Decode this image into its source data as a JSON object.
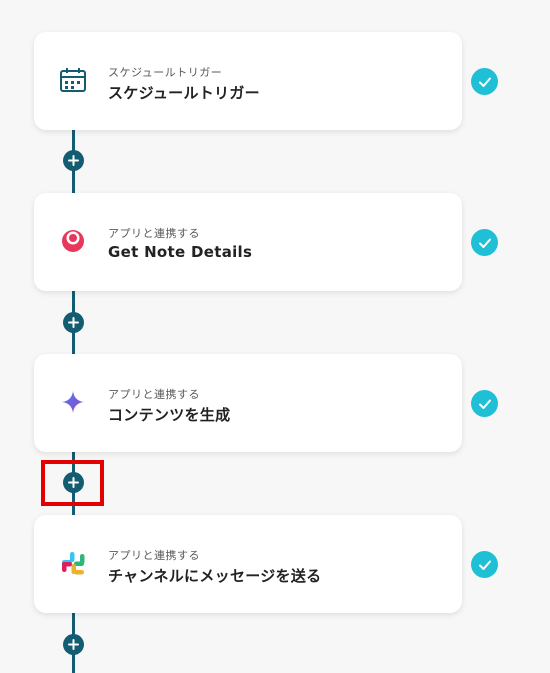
{
  "steps": [
    {
      "subtitle": "スケジュールトリガー",
      "title": "スケジュールトリガー",
      "icon": "calendar-clock-icon",
      "status": "completed"
    },
    {
      "subtitle": "アプリと連携する",
      "title": "Get Note Details",
      "icon": "note-app-icon",
      "status": "completed"
    },
    {
      "subtitle": "アプリと連携する",
      "title": "コンテンツを生成",
      "icon": "ai-sparkle-icon",
      "status": "completed"
    },
    {
      "subtitle": "アプリと連携する",
      "title": "チャンネルにメッセージを送る",
      "icon": "slack-icon",
      "status": "completed"
    }
  ],
  "colors": {
    "connector": "#145c72",
    "check": "#1fc0d6",
    "highlight": "#e30000",
    "background": "#f7f7f7"
  }
}
